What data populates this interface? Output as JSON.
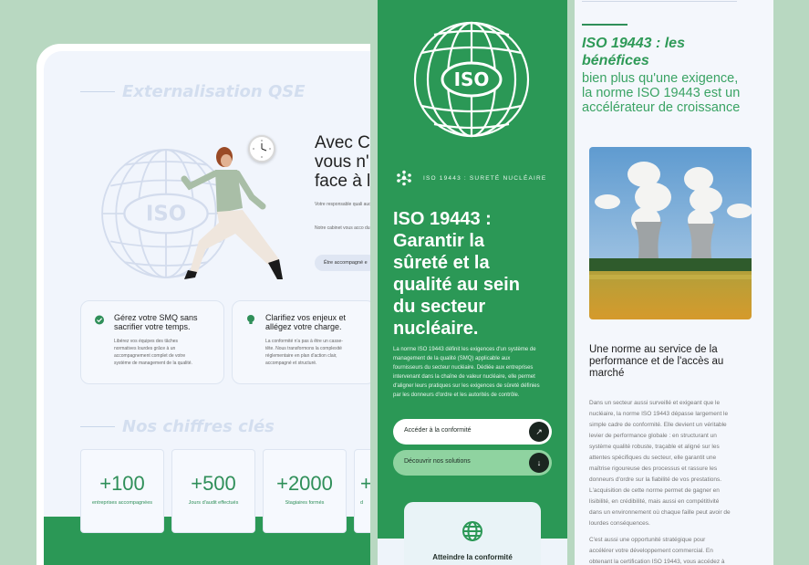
{
  "left": {
    "section1_title": "Externalisation QSE",
    "headline": "Avec C\nvous n'\nface à l",
    "para1": "Votre responsable quali\naudits et les échéances",
    "para2": "Notre cabinet vous acco\ndurablement votre systè",
    "pill_label": "Être accompagné e",
    "globe_text": "ISO",
    "cards": [
      {
        "title": "Gérez votre SMQ sans\nsacrifier votre temps.",
        "body": "Libérez vos équipes des tâches\nnormatives lourdes grâce à un\naccompagnement complet de votre\nsystème de management de la qualité.",
        "icon": "clock-check-icon"
      },
      {
        "title": "Clarifiez vos enjeux et\nallégez votre charge.",
        "body": "La conformité n'a pas à être un casse-\ntête. Nous transformons la complexité\nréglementaire en plan d'action clair,\naccompagné et structuré.",
        "icon": "lightbulb-icon"
      }
    ],
    "section2_title": "Nos chiffres clés",
    "stats": [
      {
        "number": "+100",
        "label": "entreprises accompagnées"
      },
      {
        "number": "+500",
        "label": "Jours d'audit effectués"
      },
      {
        "number": "+2000",
        "label": "Stagiaires formés"
      },
      {
        "number": "+",
        "label": "d"
      }
    ]
  },
  "middle": {
    "badge_text": "ISO",
    "kicker": "ISO 19443 : SURETÉ NUCLÉAIRE",
    "title": "ISO 19443 :\nGarantir la\nsûreté et la\nqualité au sein\ndu secteur\nnucléaire.",
    "paragraph": "La norme ISO 19443 définit les exigences d'un système de\nmanagement de la qualité (SMQ) applicable aux\nfournisseurs du secteur nucléaire. Dédiée aux entreprises\nintervenant dans la chaîne de valeur nucléaire, elle permet\nd'aligner leurs pratiques sur les exigences de sûreté définies\npar les donneurs d'ordre et les autorités de contrôle.",
    "btn_primary": "Accéder à la conformité",
    "btn_secondary": "Découvrir nos solutions",
    "card_label": "Atteindre la conformité",
    "colors": {
      "green": "#2b9856",
      "light_green": "#8fd3a0"
    }
  },
  "right": {
    "title": "ISO 19443 : les\nbénéfices",
    "subtitle": "bien plus qu'une exigence,\nla norme ISO 19443 est un\naccélérateur de croissance",
    "h2": "Une norme au service de la\nperformance et de l'accès au\nmarché",
    "body1": "Dans un secteur aussi surveillé et exigeant que le\nnucléaire, la norme ISO 19443 dépasse largement le\nsimple cadre de conformité. Elle devient un véritable\nlevier de performance globale : en structurant un\nsystème qualité robuste, traçable et aligné sur les\nattentes spécifiques du secteur, elle garantit une\nmaîtrise rigoureuse des processus et rassure les\ndonneurs d'ordre sur la fiabilité de vos prestations.\nL'acquisition de cette norme permet de gagner en\nlisibilité, en crédibilité, mais aussi en compétitivité\ndans un environnement où chaque faille peut avoir de\nlourdes conséquences.",
    "body2": "C'est aussi une opportunité stratégique pour\naccélérer votre développement commercial. En\nobtenant la certification ISO 19443, vous accédez à"
  }
}
